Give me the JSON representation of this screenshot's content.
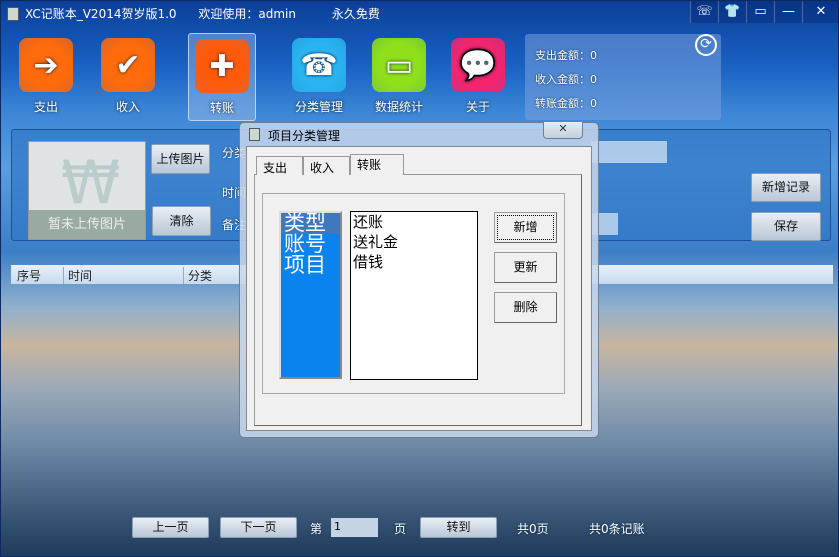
{
  "window": {
    "title": "XC记账本_V2014贺岁版1.0",
    "welcome": "欢迎使用：admin",
    "license": "永久免费",
    "controls": [
      "feedback",
      "skin",
      "menu",
      "minimize",
      "close"
    ],
    "control_glyphs": [
      "☏",
      "👕",
      "▭",
      "—",
      "✕"
    ]
  },
  "toolbar": [
    {
      "label": "支出",
      "icon": "arrow-right-icon",
      "glyph": "➔",
      "color": "#ff6a0a"
    },
    {
      "label": "收入",
      "icon": "check-icon",
      "glyph": "✔",
      "color": "#ff6a0a"
    },
    {
      "label": "转账",
      "icon": "plus-icon",
      "glyph": "✚",
      "color": "#ff5a0a"
    },
    {
      "label": "分类管理",
      "icon": "phone-icon",
      "glyph": "☎",
      "color": "#29b4f0"
    },
    {
      "label": "数据统计",
      "icon": "calendar-icon",
      "glyph": "▭",
      "color": "#8fe01a"
    },
    {
      "label": "关于",
      "icon": "speech-bubble-icon",
      "glyph": "💬",
      "color": "#f5246e"
    }
  ],
  "summary": {
    "expense": "支出金额：0",
    "income": "收入金额：0",
    "transfer": "转账金额：0"
  },
  "form": {
    "image_placeholder": "暂未上传图片",
    "upload": "上传图片",
    "clear": "清除",
    "category_label": "分类",
    "time_label": "时间",
    "note_label": "备注",
    "new_record": "新增记录",
    "save": "保存"
  },
  "table": {
    "columns": [
      "序号",
      "时间",
      "分类"
    ]
  },
  "pager": {
    "prev": "上一页",
    "next": "下一页",
    "page_prefix": "第",
    "page_value": "1",
    "page_suffix": "页",
    "goto": "转到",
    "total_pages": "共0页",
    "total_records": "共0条记账"
  },
  "dialog": {
    "title": "项目分类管理",
    "close": "✕",
    "tabs": [
      "支出",
      "收入",
      "转账"
    ],
    "active_tab": 2,
    "types": [
      "类型",
      "账号",
      "项目"
    ],
    "items": [
      "还账",
      "送礼金",
      "借钱"
    ],
    "add": "新增",
    "update": "更新",
    "delete": "删除"
  }
}
